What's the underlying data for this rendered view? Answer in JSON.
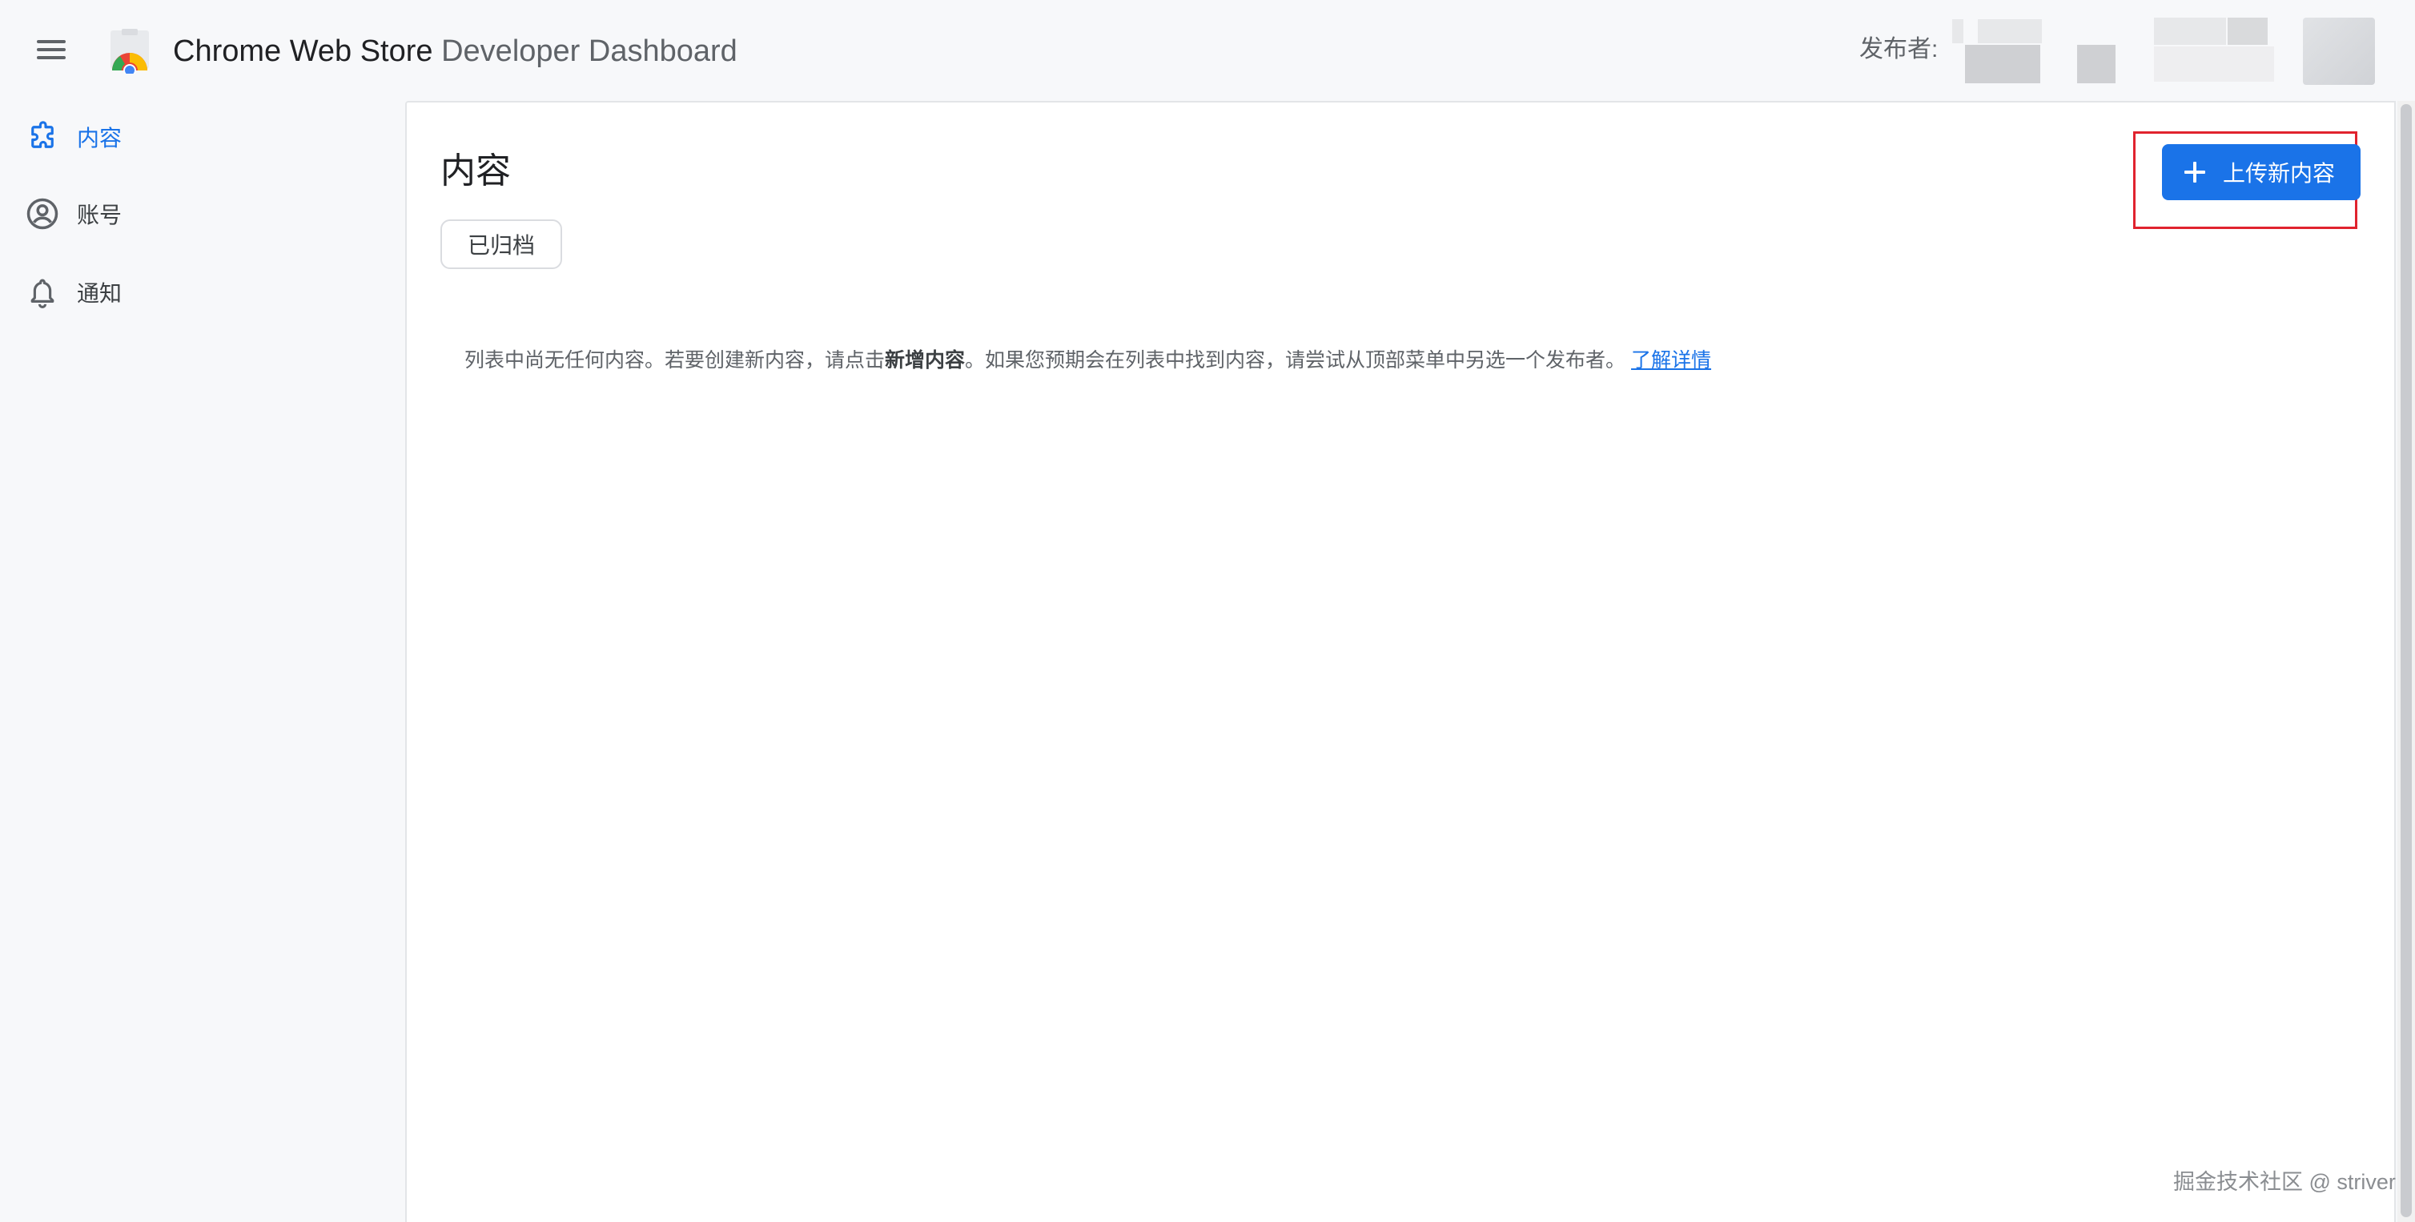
{
  "header": {
    "title_main": "Chrome Web Store",
    "title_sub": " Developer Dashboard",
    "publisher_label": "发布者:",
    "menu_icon": "hamburger-menu-icon",
    "logo_icon": "chrome-web-store-logo"
  },
  "sidebar": {
    "items": [
      {
        "label": "内容",
        "icon": "puzzle-icon",
        "active": true
      },
      {
        "label": "账号",
        "icon": "account-circle-icon",
        "active": false
      },
      {
        "label": "通知",
        "icon": "bell-icon",
        "active": false
      }
    ]
  },
  "main": {
    "title": "内容",
    "archived_chip": "已归档",
    "upload_button": "上传新内容",
    "empty_message": {
      "before": "列表中尚无任何内容。若要创建新内容，请点击",
      "bold": "新增内容",
      "after": "。如果您预期会在列表中找到内容，请尝试从顶部菜单中另选一个发布者。",
      "link": "了解详情"
    }
  },
  "watermark": "掘金技术社区 @ striver",
  "colors": {
    "accent": "#1a73e8",
    "highlight_box": "#e0232e",
    "background": "#f7f8fa"
  }
}
